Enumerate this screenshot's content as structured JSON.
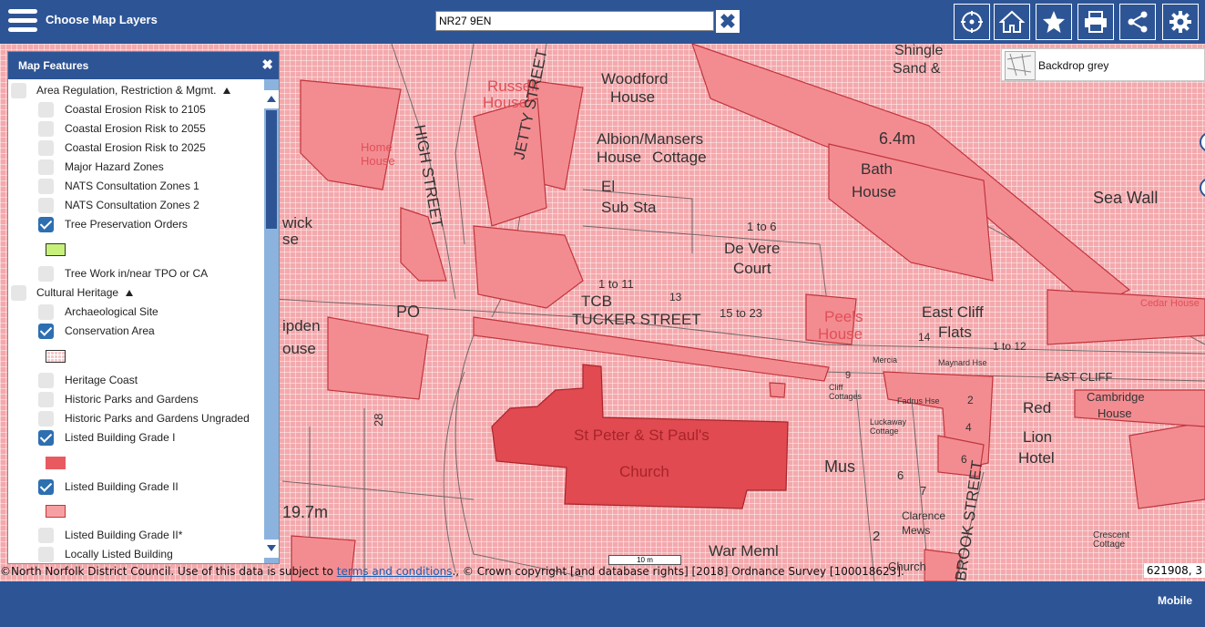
{
  "header": {
    "title": "Choose Map Layers",
    "search_value": "NR27 9EN",
    "tools": [
      "locate-icon",
      "home-icon",
      "star-icon",
      "print-icon",
      "share-icon",
      "gear-icon"
    ]
  },
  "backdrop": {
    "label": "Backdrop grey"
  },
  "panel": {
    "title": "Map Features",
    "items": [
      {
        "label": "Area Regulation, Restriction & Mgmt.",
        "checked": false,
        "group": true
      },
      {
        "label": "Coastal Erosion Risk to 2105",
        "checked": false
      },
      {
        "label": "Coastal Erosion Risk to 2055",
        "checked": false
      },
      {
        "label": "Coastal Erosion Risk to 2025",
        "checked": false
      },
      {
        "label": "Major Hazard Zones",
        "checked": false
      },
      {
        "label": "NATS Consultation Zones 1",
        "checked": false
      },
      {
        "label": "NATS Consultation Zones 2",
        "checked": false
      },
      {
        "label": "Tree Preservation Orders",
        "checked": true,
        "swatch": "#c7f07a"
      },
      {
        "label": "Tree Work in/near TPO or CA",
        "checked": false
      },
      {
        "label": "Cultural Heritage",
        "checked": false,
        "group": true
      },
      {
        "label": "Archaeological Site",
        "checked": false
      },
      {
        "label": "Conservation Area",
        "checked": true,
        "swatch": "#f6c9cc"
      },
      {
        "label": "Heritage Coast",
        "checked": false
      },
      {
        "label": "Historic Parks and Gardens",
        "checked": false
      },
      {
        "label": "Historic Parks and Gardens Ungraded",
        "checked": false
      },
      {
        "label": "Listed Building Grade I",
        "checked": true,
        "swatch": "#e85a5f"
      },
      {
        "label": "Listed Building Grade II",
        "checked": true,
        "swatch": "#f7a0a3"
      },
      {
        "label": "Listed Building Grade II*",
        "checked": false
      },
      {
        "label": "Locally Listed Building",
        "checked": false
      }
    ]
  },
  "attribution": {
    "prefix": "©North Norfolk District Council. Use of this data is subject to ",
    "link": "terms and conditions",
    "suffix": "., © Crown copyright [and database rights] [2018] Ordnance Survey [100018623]."
  },
  "coords": "621908, 3",
  "scale": "10 m",
  "footer": {
    "mobile_label": "Mobile"
  },
  "map_labels": [
    "Sand &",
    "Shingle",
    "Woodford",
    "House",
    "Russell",
    "House",
    "HIGH STREET",
    "JETTY STREET",
    "Home",
    "House",
    "Albion/Mansers",
    "House",
    "Cottage",
    "6.4m",
    "Bath",
    "House",
    "Sea Wall",
    "El",
    "Sub Sta",
    "PO",
    "1 to 6",
    "De Vere",
    "Court",
    "1 to 11",
    "13",
    "TCB",
    "TUCKER STREET",
    "15 to 23",
    "PO",
    "Peels",
    "House",
    "East Cliff",
    "Flats",
    "1 to 12",
    "Cedar House",
    "EAST CLIFF",
    "Cambridge",
    "House",
    "Red",
    "Lion",
    "Hotel",
    "St Peter & St Paul's",
    "Church",
    "Mus",
    "Clarence",
    "Mews",
    "BROOK STREET",
    "War Meml",
    "19.7m",
    "Crescent",
    "Cottage",
    "wick",
    "se",
    "ipden",
    "ouse",
    "28",
    "Maynard Hse",
    "Mercia",
    "Fadrus Hse",
    "Luckaway",
    "Cottage",
    "Cliff",
    "Cottages",
    "Church",
    "6",
    "7",
    "2",
    "5",
    "4",
    "6",
    "9",
    "14"
  ],
  "colors": {
    "header": "#2d5596",
    "conservation": "#f6c9cc",
    "grade_i": "#e85a5f",
    "grade_ii": "#f7a0a3"
  }
}
